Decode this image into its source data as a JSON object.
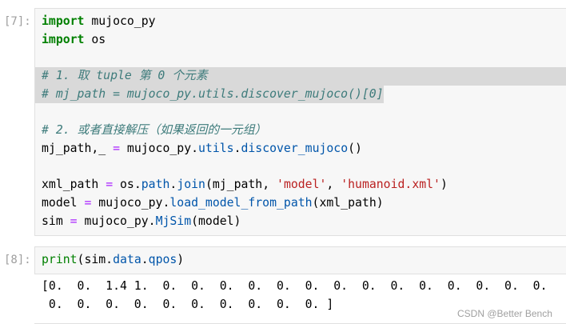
{
  "notebook": {
    "cells": [
      {
        "prompt": "[7]:",
        "lines": [
          [
            "import",
            " mujoco_py"
          ],
          [
            "import",
            " os"
          ],
          [],
          [
            "# 1. 取 tuple 第 0 个元素"
          ],
          [
            "# mj_path = mujoco_py.utils.discover_mujoco()[0]"
          ],
          [],
          [
            "# 2. 或者直接解压（如果返回的一元组）"
          ],
          [
            "mj_path,_ ",
            "=",
            " mujoco_py.",
            "utils",
            ".",
            "discover_mujoco",
            "()"
          ],
          [],
          [
            "xml_path ",
            "=",
            " os.",
            "path",
            ".",
            "join",
            "(mj_path, ",
            "'model'",
            ", ",
            "'humanoid.xml'",
            ")"
          ],
          [
            "model ",
            "=",
            " mujoco_py.",
            "load_model_from_path",
            "(xml_path)"
          ],
          [
            "sim ",
            "=",
            " mujoco_py.",
            "MjSim",
            "(model)"
          ]
        ]
      },
      {
        "prompt": "[8]:",
        "lines": [
          [
            "print",
            "(sim.",
            "data",
            ".",
            "qpos",
            ")"
          ]
        ],
        "output": [
          "[0.  0.  1.4 1.  0.  0.  0.  0.  0.  0.  0.  0.  0.  0.  0.  0.  0.  0.",
          " 0.  0.  0.  0.  0.  0.  0.  0.  0.  0. ]"
        ]
      }
    ]
  },
  "watermark": "CSDN @Better Bench",
  "colors": {
    "keyword": "#008000",
    "builtin": "#008000",
    "operator": "#aa22ff",
    "string": "#ba2121",
    "comment": "#3d7b7b",
    "attribute": "#0055aa",
    "text": "#000000",
    "prompt": "#9e9e9e",
    "selection": "#d9d9d9",
    "cellBackground": "#f7f7f7",
    "cellBorder": "#e0e0e0",
    "watermark": "#a0a0a0"
  }
}
